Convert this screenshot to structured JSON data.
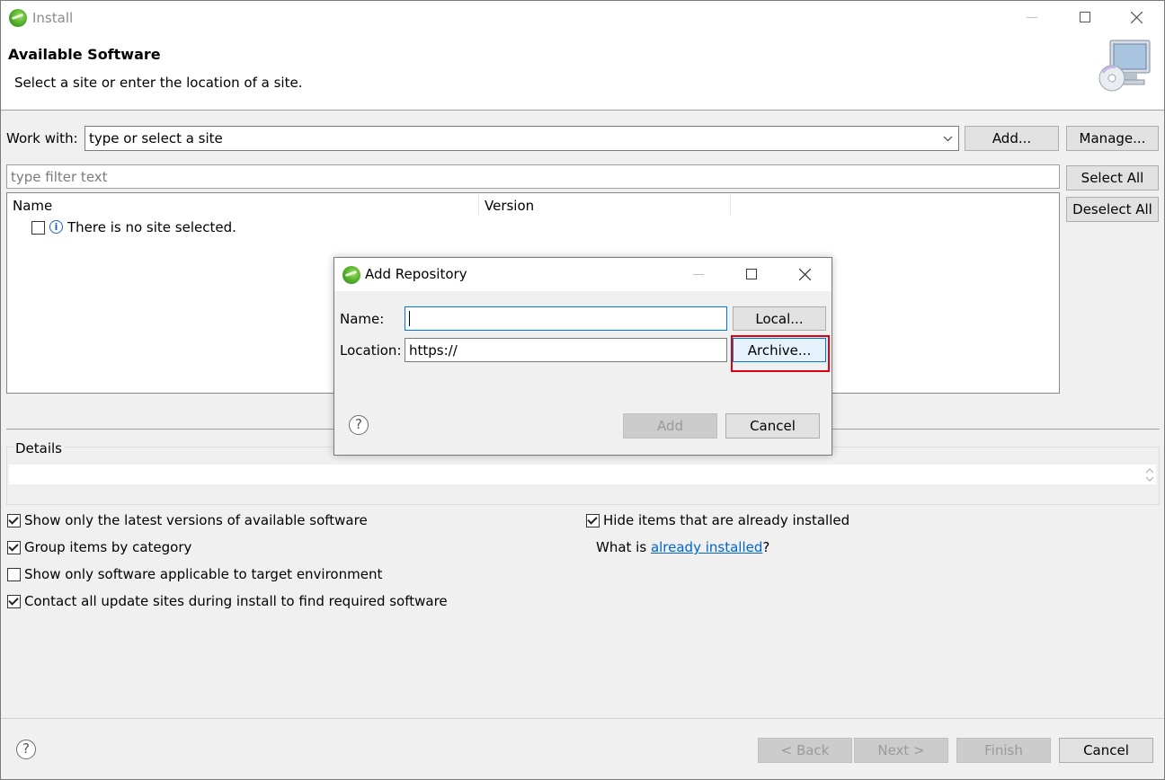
{
  "window": {
    "title": "Install",
    "banner_title": "Available Software",
    "banner_subtitle": "Select a site or enter the location of a site."
  },
  "work_with": {
    "label": "Work with:",
    "placeholder": "type or select a site",
    "add_button": "Add...",
    "manage_button": "Manage..."
  },
  "filter": {
    "placeholder": "type filter text",
    "select_all_button": "Select All",
    "deselect_all_button": "Deselect All"
  },
  "table": {
    "columns": [
      "Name",
      "Version"
    ],
    "empty_message": "There is no site selected."
  },
  "details": {
    "label": "Details"
  },
  "options": [
    {
      "label": "Show only the latest versions of available software",
      "checked": true
    },
    {
      "label": "Group items by category",
      "checked": true
    },
    {
      "label": "Show only software applicable to target environment",
      "checked": false
    },
    {
      "label": "Contact all update sites during install to find required software",
      "checked": true
    }
  ],
  "hide_installed": {
    "label": "Hide items that are already installed",
    "checked": true
  },
  "already_installed": {
    "prefix": "What is ",
    "link": "already installed",
    "suffix": "?"
  },
  "footer": {
    "back_button": "< Back",
    "next_button": "Next >",
    "finish_button": "Finish",
    "cancel_button": "Cancel"
  },
  "dialog": {
    "title": "Add Repository",
    "name_label": "Name:",
    "name_value": "",
    "location_label": "Location:",
    "location_value": "https://",
    "local_button": "Local...",
    "archive_button": "Archive...",
    "add_button": "Add",
    "cancel_button": "Cancel"
  },
  "colors": {
    "link": "#0066cc",
    "highlight": "#e0000f",
    "focus_border": "#0078d7"
  }
}
